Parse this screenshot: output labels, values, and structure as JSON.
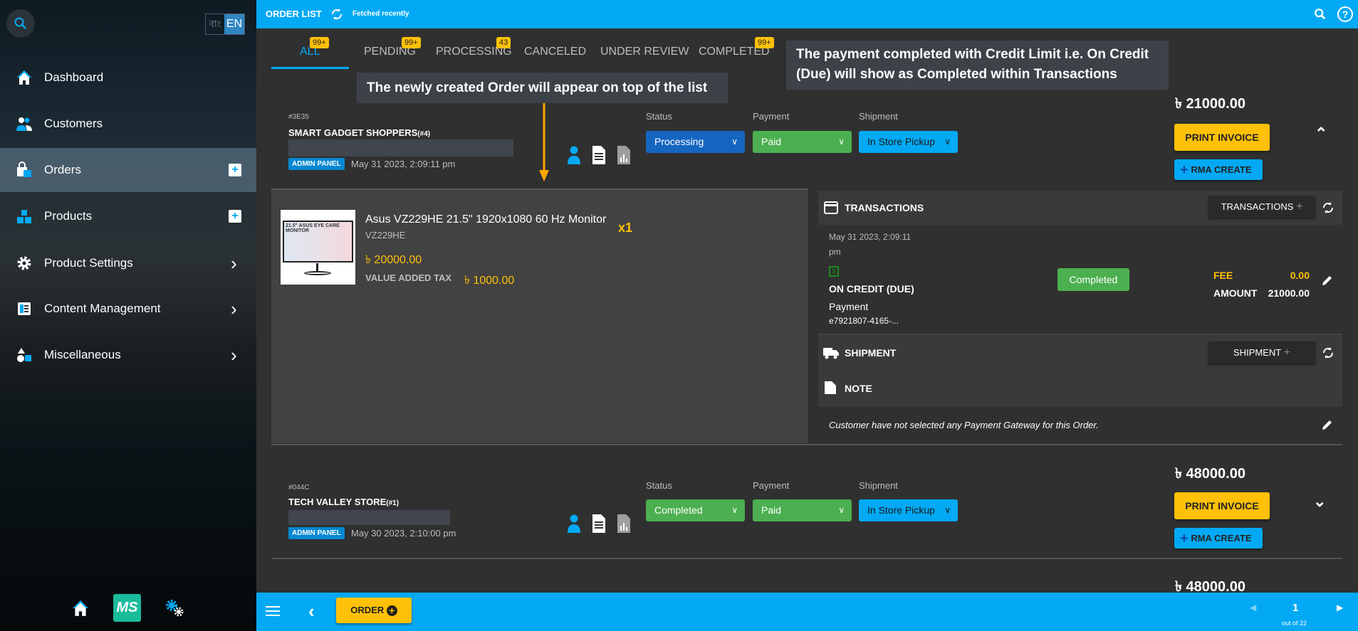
{
  "sidebar": {
    "lang": {
      "bn": "বাং",
      "en": "EN"
    },
    "items": [
      {
        "label": "Dashboard",
        "icon": "home-icon"
      },
      {
        "label": "Customers",
        "icon": "users-icon"
      },
      {
        "label": "Orders",
        "icon": "shopping-bag-icon",
        "active": true
      },
      {
        "label": "Products",
        "icon": "boxes-icon"
      },
      {
        "label": "Product Settings",
        "icon": "gear-icon"
      },
      {
        "label": "Content Management",
        "icon": "content-icon"
      },
      {
        "label": "Miscellaneous",
        "icon": "shapes-icon"
      }
    ],
    "logo": "MS"
  },
  "header": {
    "title": "ORDER LIST",
    "status": "Fetched recently"
  },
  "tabs": [
    {
      "label": "ALL",
      "badge": "99+",
      "active": true
    },
    {
      "label": "PENDING",
      "badge": "99+"
    },
    {
      "label": "PROCESSING",
      "badge": "43"
    },
    {
      "label": "CANCELED"
    },
    {
      "label": "UNDER REVIEW"
    },
    {
      "label": "COMPLETED",
      "badge": "99+"
    }
  ],
  "annotations": {
    "top": "The newly created Order will appear on top of the list",
    "right": "The payment completed with Credit Limit i.e. On Credit (Due) will show as Completed within Transactions"
  },
  "labels": {
    "status": "Status",
    "payment": "Payment",
    "shipment": "Shipment",
    "print": "PRINT INVOICE",
    "rma": "RMA CREATE",
    "admin": "ADMIN PANEL"
  },
  "orders": [
    {
      "id": "#3E35",
      "customer": "SMART GADGET SHOPPERS",
      "customer_no": "(#4)",
      "date": "May 31 2023, 2:09:11 pm",
      "status": "Processing",
      "payment": "Paid",
      "shipment": "In Store Pickup",
      "total": "৳ 21000.00",
      "expanded": true
    },
    {
      "id": "#044C",
      "customer": "TECH VALLEY STORE",
      "customer_no": "(#1)",
      "date": "May 30 2023, 2:10:00 pm",
      "status": "Completed",
      "payment": "Paid",
      "shipment": "In Store Pickup",
      "total": "৳ 48000.00"
    },
    {
      "total": "৳ 48000.00"
    }
  ],
  "item": {
    "name": "Asus VZ229HE 21.5\" 1920x1080 60 Hz Monitor",
    "sku": "VZ229HE",
    "price": "৳ 20000.00",
    "vat_label": "VALUE ADDED TAX",
    "vat": "৳ 1000.00",
    "qty": "x1",
    "image_text": "21.5\" ASUS EYE CARE MONITOR"
  },
  "transactions": {
    "title": "TRANSACTIONS",
    "button": "TRANSACTIONS",
    "date_line1": "May 31 2023, 2:09:11",
    "date_line2": "pm",
    "method": "ON CREDIT (DUE)",
    "type": "Payment",
    "ref": "e7921807-4165-...",
    "status": "Completed",
    "fee_label": "FEE",
    "fee": "0.00",
    "amount_label": "AMOUNT",
    "amount": "21000.00"
  },
  "shipment": {
    "title": "SHIPMENT",
    "button": "SHIPMENT"
  },
  "note": {
    "title": "NOTE",
    "text": "Customer have not selected any Payment Gateway for this Order."
  },
  "bottom": {
    "order_button": "ORDER",
    "page": "1",
    "out_of": "out of 22"
  },
  "colors": {
    "primary": "#03A9F4",
    "accent": "#FFC107",
    "success": "#4CAF50",
    "processing": "#1565C0"
  }
}
